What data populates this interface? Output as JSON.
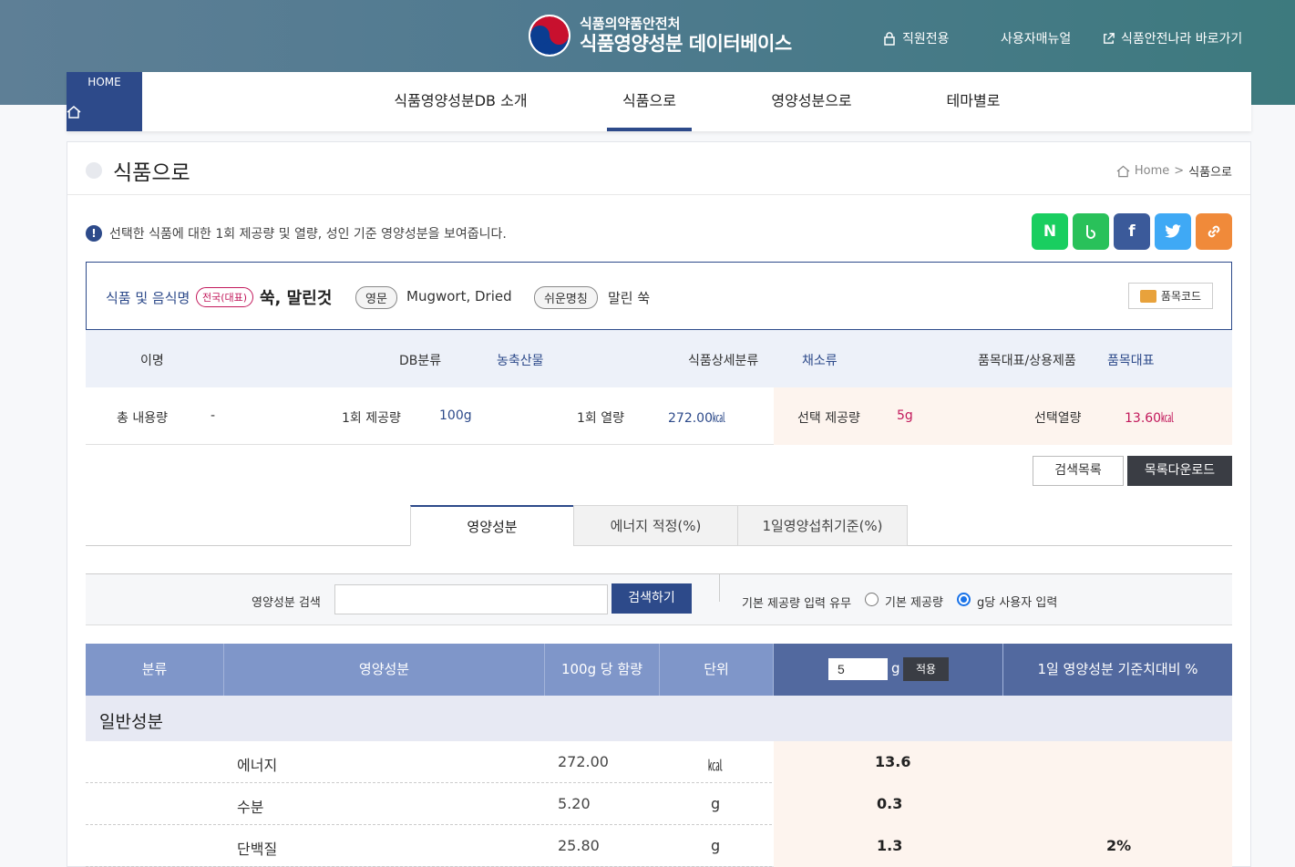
{
  "header": {
    "agency": "식품의약품안전처",
    "site_title": "식품영양성분 데이터베이스",
    "util_links": [
      "직원전용",
      "사용자매뉴얼",
      "식품안전나라 바로가기"
    ]
  },
  "gnb": {
    "home_label": "HOME",
    "items": [
      "식품영양성분DB 소개",
      "식품으로",
      "영양성분으로",
      "테마별로"
    ],
    "active": "식품으로"
  },
  "page": {
    "title": "식품으로",
    "breadcrumb": [
      "Home",
      ">",
      "식품으로"
    ],
    "notice": "선택한 식품에 대한 1회 제공량 및 열량, 성인 기준 영양성분을 보여줍니다.",
    "share_buttons": [
      "N",
      "b",
      "f",
      "t",
      "link"
    ]
  },
  "food": {
    "label": "식품 및 음식명",
    "tag": "전국(대표)",
    "name": "쑥, 말린것",
    "en_label": "영문",
    "en_name": "Mugwort, Dried",
    "easy_label": "쉬운명칭",
    "easy_name": "말린 쑥",
    "code_button": "품목코드"
  },
  "info_row1": {
    "alias_label": "이명",
    "db_label": "DB분류",
    "db_value": "농축산물",
    "detail_label": "식품상세분류",
    "detail_value": "채소류",
    "rep_label": "품목대표/상용제품",
    "rep_value": "품목대표"
  },
  "info_row2": {
    "total_label": "총 내용량",
    "total_value": "-",
    "serving_label": "1회 제공량",
    "serving_value": "100g",
    "kcal_label": "1회 열량",
    "kcal_value": "272.00㎉",
    "sel_serving_label": "선택 제공량",
    "sel_serving_value": "5g",
    "sel_kcal_label": "선택열량",
    "sel_kcal_value": "13.60㎉"
  },
  "actions": {
    "list": "검색목록",
    "download": "목록다운로드"
  },
  "tabs": [
    "영양성분",
    "에너지 적정(%)",
    "1일영양섭취기준(%)"
  ],
  "search": {
    "label": "영양성분 검색",
    "placeholder": "",
    "button": "검색하기",
    "radio_label": "기본 제공량 입력 유무",
    "radio_options": [
      "기본 제공량",
      "g당 사용자 입력"
    ],
    "radio_selected": "g당 사용자 입력"
  },
  "table": {
    "headers": [
      "분류",
      "영양성분",
      "100g 당 함량",
      "단위",
      "1일 영양성분 기준치대비 %"
    ],
    "gram_input": "5",
    "gram_unit": "g",
    "apply": "적용",
    "section": "일반성분",
    "rows": [
      {
        "name": "에너지",
        "per100": "272.00",
        "unit": "㎉",
        "value": "13.6",
        "pct": ""
      },
      {
        "name": "수분",
        "per100": "5.20",
        "unit": "g",
        "value": "0.3",
        "pct": ""
      },
      {
        "name": "단백질",
        "per100": "25.80",
        "unit": "g",
        "value": "1.3",
        "pct": "2%"
      }
    ]
  }
}
